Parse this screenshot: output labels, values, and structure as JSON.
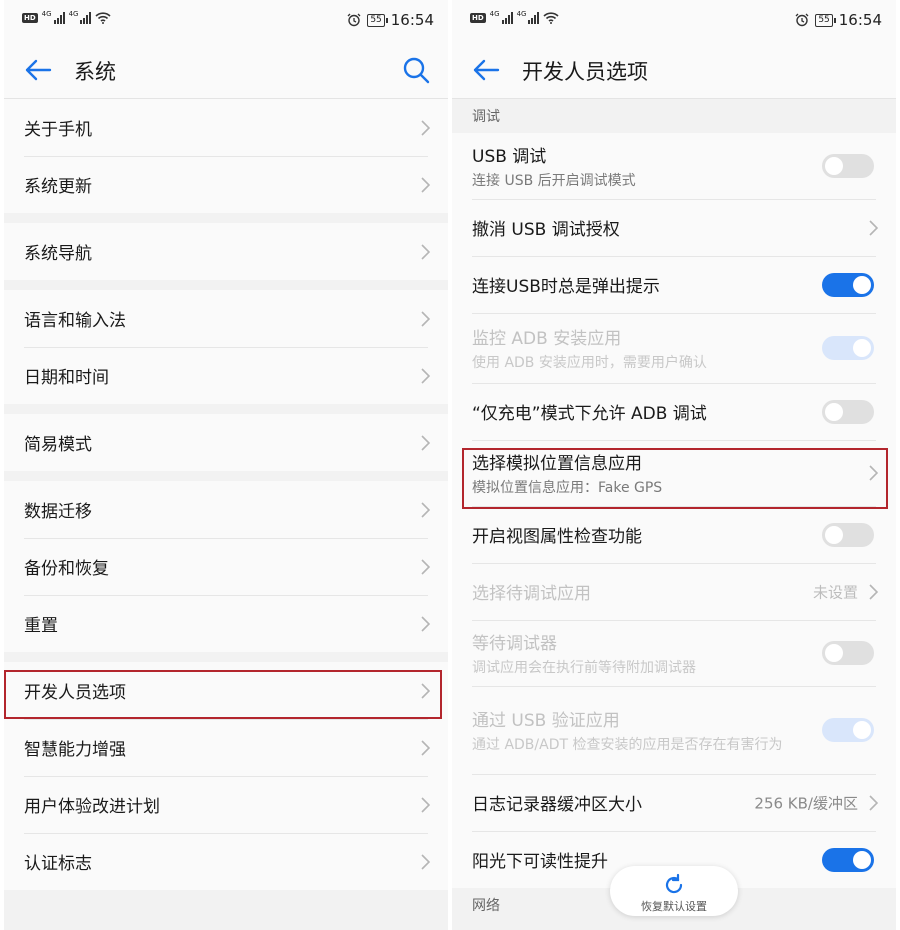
{
  "status_bar": {
    "hd": "HD",
    "net1": "4G",
    "net2": "4G",
    "battery": "55",
    "time": "16:54"
  },
  "left_screen": {
    "title": "系统",
    "groups": [
      [
        "关于手机",
        "系统更新"
      ],
      [
        "系统导航"
      ],
      [
        "语言和输入法",
        "日期和时间"
      ],
      [
        "简易模式"
      ],
      [
        "数据迁移",
        "备份和恢复",
        "重置"
      ],
      [
        "开发人员选项",
        "智慧能力增强",
        "用户体验改进计划",
        "认证标志"
      ]
    ]
  },
  "right_screen": {
    "title": "开发人员选项",
    "section": "调试",
    "items": [
      {
        "title": "USB 调试",
        "sub": "连接 USB 后开启调试模式",
        "toggle": "off"
      },
      {
        "title": "撤消 USB 调试授权"
      },
      {
        "title": "连接USB时总是弹出提示",
        "toggle": "on"
      },
      {
        "title": "监控 ADB 安装应用",
        "sub": "使用 ADB 安装应用时，需要用户确认",
        "toggle": "on",
        "disabled": true
      },
      {
        "title": "“仅充电”模式下允许 ADB 调试",
        "toggle": "off"
      },
      {
        "title": "选择模拟位置信息应用",
        "sub": "模拟位置信息应用：Fake GPS"
      },
      {
        "title": "开启视图属性检查功能",
        "toggle": "off"
      },
      {
        "title": "选择待调试应用",
        "value": "未设置",
        "disabled": true
      },
      {
        "title": "等待调试器",
        "sub": "调试应用会在执行前等待附加调试器",
        "toggle": "off",
        "disabled": true
      },
      {
        "title": "通过 USB 验证应用",
        "sub": "通过 ADB/ADT 检查安装的应用是否存在有害行为",
        "toggle": "on",
        "disabled": true
      },
      {
        "title": "日志记录器缓冲区大小",
        "value": "256 KB/缓冲区"
      },
      {
        "title": "阳光下可读性提升",
        "toggle": "on"
      }
    ],
    "next_section": "网络",
    "restore_label": "恢复默认设置"
  },
  "colors": {
    "accent": "#1a73e8",
    "highlight": "#b3262d"
  }
}
